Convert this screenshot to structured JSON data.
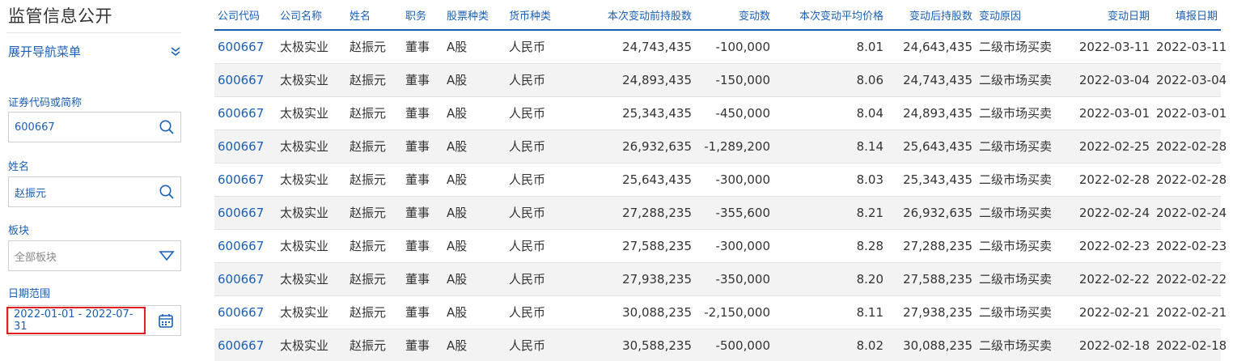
{
  "sidebar": {
    "title": "监管信息公开",
    "nav_toggle": "展开导航菜单",
    "fields": {
      "code_label": "证券代码或简称",
      "code_value": "600667",
      "name_label": "姓名",
      "name_value": "赵振元",
      "board_label": "板块",
      "board_value": "全部板块",
      "date_label": "日期范围",
      "date_value": "2022-01-01 - 2022-07-31"
    }
  },
  "table": {
    "headers": [
      "公司代码",
      "公司名称",
      "姓名",
      "职务",
      "股票种类",
      "货币种类",
      "本次变动前持股数",
      "变动数",
      "本次变动平均价格",
      "变动后持股数",
      "变动原因",
      "变动日期",
      "填报日期"
    ],
    "rows": [
      [
        "600667",
        "太极实业",
        "赵振元",
        "董事",
        "A股",
        "人民币",
        "24,743,435",
        "-100,000",
        "8.01",
        "24,643,435",
        "二级市场买卖",
        "2022-03-11",
        "2022-03-11"
      ],
      [
        "600667",
        "太极实业",
        "赵振元",
        "董事",
        "A股",
        "人民币",
        "24,893,435",
        "-150,000",
        "8.06",
        "24,743,435",
        "二级市场买卖",
        "2022-03-04",
        "2022-03-04"
      ],
      [
        "600667",
        "太极实业",
        "赵振元",
        "董事",
        "A股",
        "人民币",
        "25,343,435",
        "-450,000",
        "8.04",
        "24,893,435",
        "二级市场买卖",
        "2022-03-01",
        "2022-03-01"
      ],
      [
        "600667",
        "太极实业",
        "赵振元",
        "董事",
        "A股",
        "人民币",
        "26,932,635",
        "-1,289,200",
        "8.14",
        "25,643,435",
        "二级市场买卖",
        "2022-02-25",
        "2022-02-28"
      ],
      [
        "600667",
        "太极实业",
        "赵振元",
        "董事",
        "A股",
        "人民币",
        "25,643,435",
        "-300,000",
        "8.03",
        "25,343,435",
        "二级市场买卖",
        "2022-02-28",
        "2022-02-28"
      ],
      [
        "600667",
        "太极实业",
        "赵振元",
        "董事",
        "A股",
        "人民币",
        "27,288,235",
        "-355,600",
        "8.21",
        "26,932,635",
        "二级市场买卖",
        "2022-02-24",
        "2022-02-24"
      ],
      [
        "600667",
        "太极实业",
        "赵振元",
        "董事",
        "A股",
        "人民币",
        "27,588,235",
        "-300,000",
        "8.28",
        "27,288,235",
        "二级市场买卖",
        "2022-02-23",
        "2022-02-23"
      ],
      [
        "600667",
        "太极实业",
        "赵振元",
        "董事",
        "A股",
        "人民币",
        "27,938,235",
        "-350,000",
        "8.20",
        "27,588,235",
        "二级市场买卖",
        "2022-02-22",
        "2022-02-22"
      ],
      [
        "600667",
        "太极实业",
        "赵振元",
        "董事",
        "A股",
        "人民币",
        "30,088,235",
        "-2,150,000",
        "8.11",
        "27,938,235",
        "二级市场买卖",
        "2022-02-21",
        "2022-02-21"
      ],
      [
        "600667",
        "太极实业",
        "赵振元",
        "董事",
        "A股",
        "人民币",
        "30,588,235",
        "-500,000",
        "8.02",
        "30,088,235",
        "二级市场买卖",
        "2022-02-18",
        "2022-02-18"
      ]
    ]
  },
  "colors": {
    "accent": "#1a5fb4",
    "highlight": "#e02020",
    "row_stripe": "#f3f3f3"
  },
  "icons": {
    "code_search": "search-icon",
    "name_search": "search-icon",
    "board_dropdown": "triangle-down-icon",
    "date_picker": "calendar-icon",
    "nav_toggle": "double-chevron-down-icon"
  }
}
